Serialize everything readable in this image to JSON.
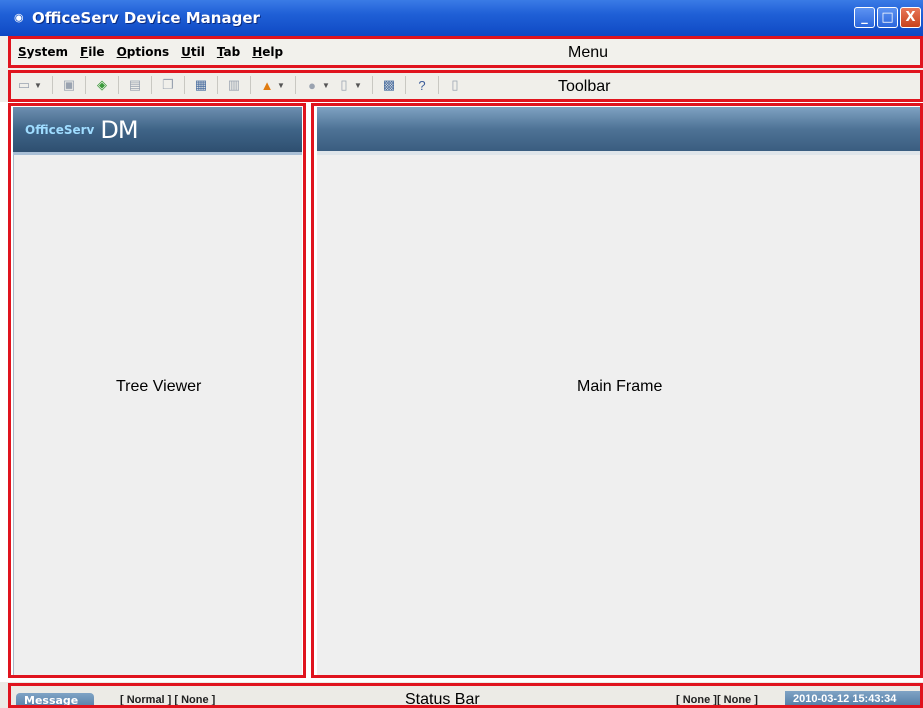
{
  "window": {
    "title": "OfficeServ Device Manager",
    "minimize": "_",
    "maximize": "□",
    "close": "X"
  },
  "menu": {
    "items": [
      {
        "key": "S",
        "rest": "ystem"
      },
      {
        "key": "F",
        "rest": "ile"
      },
      {
        "key": "O",
        "rest": "ptions"
      },
      {
        "key": "U",
        "rest": "til"
      },
      {
        "key": "T",
        "rest": "ab"
      },
      {
        "key": "H",
        "rest": "elp"
      }
    ]
  },
  "annotations": {
    "menu": "Menu",
    "toolbar": "Toolbar",
    "tree": "Tree Viewer",
    "main": "Main Frame",
    "status": "Status Bar"
  },
  "tree": {
    "logo_small": "OfficeServ",
    "logo_large": "DM"
  },
  "status": {
    "message_tab": "Message",
    "left_text": "[ Normal ]  [ None ]",
    "right_text": "[ None ][ None ]",
    "datetime": "2010-03-12 15:43:34"
  },
  "colors": {
    "annotation_border": "#e0141e",
    "titlebar": "#1f5fd6",
    "panel_header": "#3f6487"
  }
}
